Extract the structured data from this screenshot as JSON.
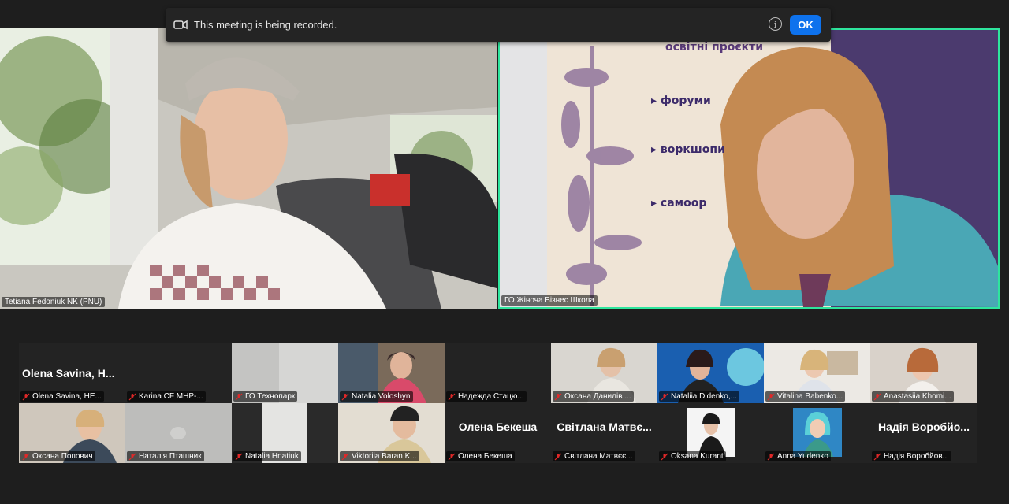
{
  "recording_banner": {
    "message": "This meeting is being recorded.",
    "info_icon": "info-icon",
    "ok_label": "OK"
  },
  "main_videos": [
    {
      "name": "Tetiana Fedoniuk NK (PNU)"
    },
    {
      "name": "ГО Жіноча Бізнес Школа",
      "active_speaker": true
    }
  ],
  "banner_text": [
    "освітні проєкти",
    "форуми",
    "воркшопи",
    "самоор"
  ],
  "participants": [
    {
      "name": "Olena Savina, HE...",
      "big": "Olena Savina, H...",
      "muted": true
    },
    {
      "name": "Karina CF МНР-...",
      "muted": true
    },
    {
      "name": "ГО Технопарк",
      "muted": true
    },
    {
      "name": "Natalia Voloshyn",
      "muted": true
    },
    {
      "name": "Надежда Стацю...",
      "muted": true
    },
    {
      "name": "Оксана Данилів ...",
      "muted": true
    },
    {
      "name": "Nataliia Didenko,...",
      "muted": true
    },
    {
      "name": "Vitalina Babenko...",
      "muted": true
    },
    {
      "name": "Anastasiia Khomi...",
      "muted": true
    },
    {
      "name": "Оксана Попович",
      "muted": true
    },
    {
      "name": "Наталія Пташник",
      "muted": true
    },
    {
      "name": "Natalia Hnatiuk",
      "muted": true
    },
    {
      "name": "Viktoriia Baran K...",
      "muted": true
    },
    {
      "name": "Олена Бекеша",
      "big": "Олена Бекеша",
      "muted": true
    },
    {
      "name": "Світлана Матвєє...",
      "big": "Світлана Матвє...",
      "muted": true
    },
    {
      "name": "Oksana Kurant",
      "muted": true
    },
    {
      "name": "Anna Yudenko",
      "muted": true
    },
    {
      "name": "Надія Воробйов...",
      "big": "Надія Воробйо...",
      "muted": true
    }
  ],
  "colors": {
    "active_border": "#2ee59d",
    "ok_button": "#0e72ed",
    "mute_icon": "#e02828"
  }
}
